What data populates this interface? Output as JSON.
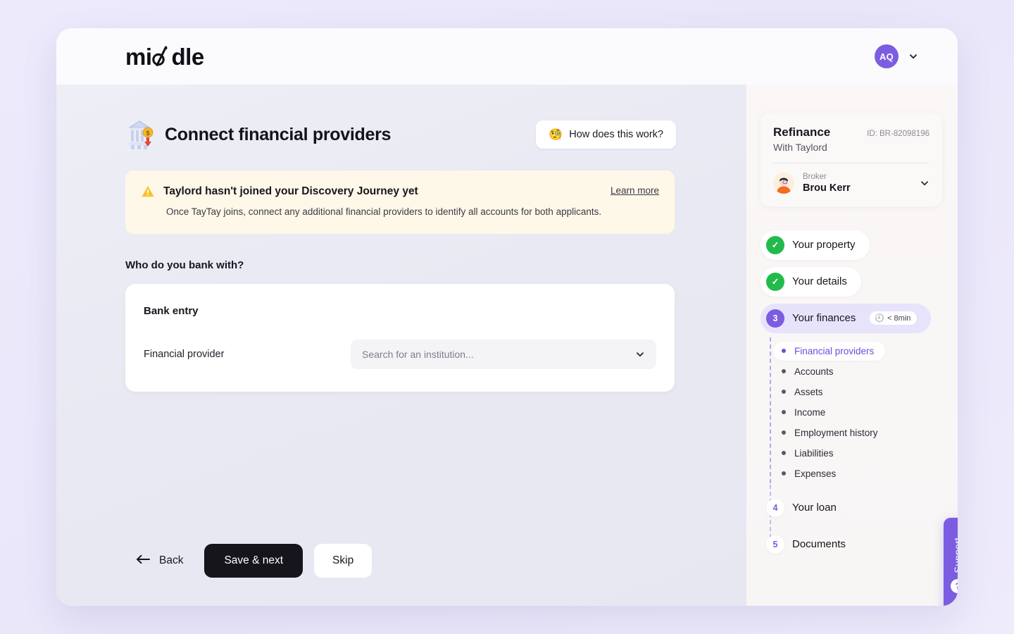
{
  "header": {
    "logo_text": "middle",
    "avatar_initials": "AQ",
    "avatar_color": "#7C5CE0",
    "chevron_icon": "chevron-down-icon"
  },
  "main": {
    "title": "Connect financial providers",
    "title_icon": "bank-institution-icon",
    "how_button": {
      "label": "How does this work?",
      "emoji": "🧐"
    },
    "warning": {
      "icon": "warning-triangle-icon",
      "title": "Taylord hasn't joined your Discovery Journey yet",
      "body": "Once TayTay joins, connect any additional financial providers to identify all accounts for both applicants.",
      "link_label": "Learn more",
      "bg_color": "#FDF8E8"
    },
    "question": "Who do you bank with?",
    "card": {
      "heading": "Bank entry",
      "field_label": "Financial provider",
      "field_placeholder": "Search for an institution...",
      "field_value": "",
      "dropdown_icon": "chevron-down-icon"
    },
    "actions": {
      "back_label": "Back",
      "back_icon": "arrow-left-icon",
      "primary_label": "Save & next",
      "ghost_label": "Skip"
    }
  },
  "sidebar": {
    "deal": {
      "name": "Refinance",
      "id": "ID: BR-82098196",
      "subtitle": "With Taylord",
      "broker_role": "Broker",
      "broker_name": "Brou Kerr",
      "broker_chevron": "chevron-down-icon"
    },
    "steps": [
      {
        "label": "Your property",
        "state": "done",
        "marker": "✓"
      },
      {
        "label": "Your details",
        "state": "done",
        "marker": "✓"
      },
      {
        "label": "Your finances",
        "state": "active",
        "marker": "3",
        "time_badge": "< 8min",
        "time_emoji": "🕘"
      },
      {
        "label": "Your loan",
        "state": "upcoming",
        "marker": "4"
      },
      {
        "label": "Documents",
        "state": "upcoming",
        "marker": "5"
      }
    ],
    "substeps": [
      {
        "label": "Financial providers",
        "current": true
      },
      {
        "label": "Accounts",
        "current": false
      },
      {
        "label": "Assets",
        "current": false
      },
      {
        "label": "Income",
        "current": false
      },
      {
        "label": "Employment history",
        "current": false
      },
      {
        "label": "Liabilities",
        "current": false
      },
      {
        "label": "Expenses",
        "current": false
      }
    ],
    "support": {
      "label": "Support",
      "icon": "question-mark-icon",
      "color": "#7C5CE0"
    }
  }
}
